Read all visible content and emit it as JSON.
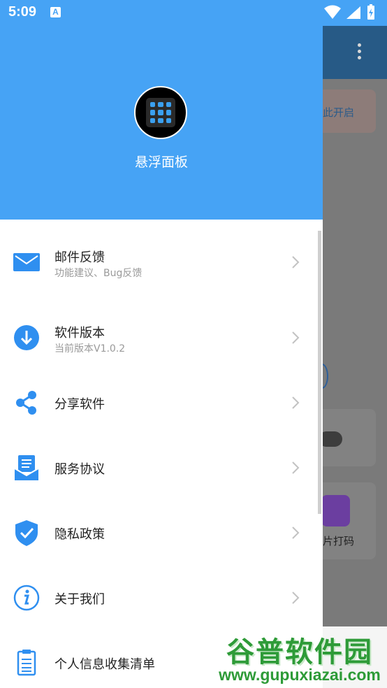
{
  "status_bar": {
    "time": "5:09",
    "notification_icon_letter": "A"
  },
  "drawer": {
    "header": {
      "app_name": "悬浮面板"
    },
    "items": [
      {
        "title": "邮件反馈",
        "subtitle": "功能建议、Bug反馈",
        "icon": "mail-icon"
      },
      {
        "title": "软件版本",
        "subtitle": "当前版本V1.0.2",
        "icon": "download-icon"
      },
      {
        "title": "分享软件",
        "subtitle": "",
        "icon": "share-icon"
      },
      {
        "title": "服务协议",
        "subtitle": "",
        "icon": "agreement-icon"
      },
      {
        "title": "隐私政策",
        "subtitle": "",
        "icon": "shield-check-icon"
      },
      {
        "title": "关于我们",
        "subtitle": "",
        "icon": "info-icon"
      },
      {
        "title": "个人信息收集清单",
        "subtitle": "",
        "icon": "clipboard-icon"
      }
    ]
  },
  "background_app": {
    "card_text": "此开启",
    "tile_text": "片打码"
  },
  "watermark": {
    "main": "谷普软件园",
    "url": "www.gupuxiazai.com"
  },
  "colors": {
    "header_blue": "#46a3f5",
    "icon_blue": "#2f8ff0"
  }
}
